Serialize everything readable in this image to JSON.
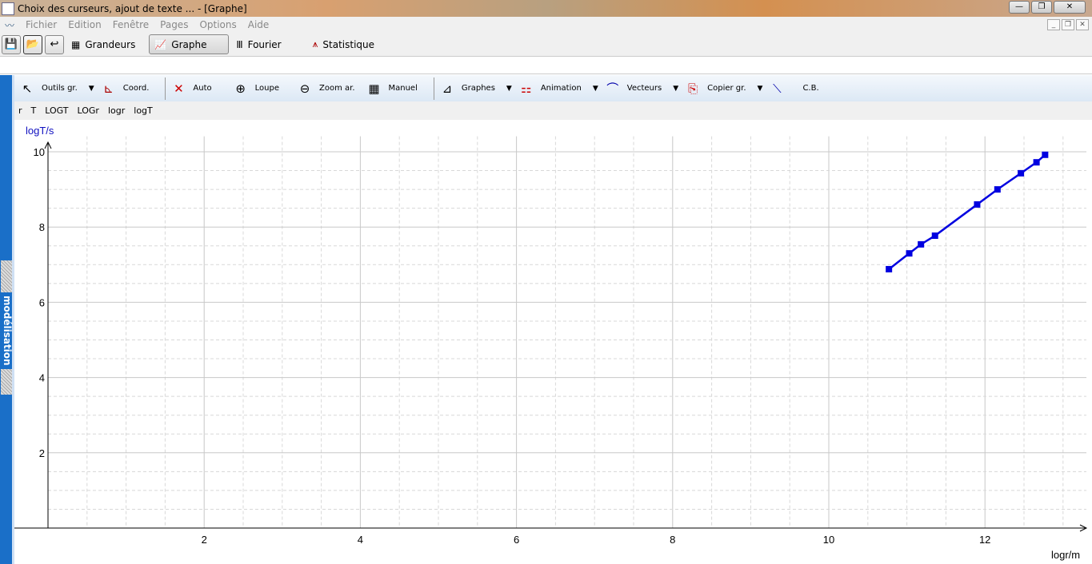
{
  "window": {
    "title": "Choix des curseurs, ajout de texte ... - [Graphe]"
  },
  "menu": [
    "Fichier",
    "Edition",
    "Fenêtre",
    "Pages",
    "Options",
    "Aide"
  ],
  "toolbar": {
    "tabs": [
      "Grandeurs",
      "Graphe",
      "Fourier",
      "Statistique"
    ],
    "active": "Graphe"
  },
  "graph_toolbar": {
    "outils": "Outils gr.",
    "coord": "Coord.",
    "auto": "Auto",
    "loupe": "Loupe",
    "zoom": "Zoom ar.",
    "manuel": "Manuel",
    "graphes": "Graphes",
    "animation": "Animation",
    "vecteurs": "Vecteurs",
    "copier": "Copier gr.",
    "cb": "C.B."
  },
  "variables": [
    "r",
    "T",
    "LOGT",
    "LOGr",
    "logr",
    "logT"
  ],
  "sidebar": {
    "tab": "modélisation"
  },
  "chart_data": {
    "type": "line",
    "xlabel": "logr/m",
    "ylabel": "logT/s",
    "xlim": [
      0,
      13.6
    ],
    "ylim": [
      0,
      10.2
    ],
    "xticks": [
      2,
      4,
      6,
      8,
      10,
      12
    ],
    "yticks": [
      2,
      4,
      6,
      8,
      10
    ],
    "grid": true,
    "color": "#0000e0",
    "x": [
      10.77,
      11.03,
      11.18,
      11.36,
      11.9,
      12.16,
      12.46,
      12.66,
      12.77
    ],
    "y": [
      6.88,
      7.3,
      7.54,
      7.77,
      8.6,
      9.0,
      9.43,
      9.72,
      9.92
    ]
  }
}
